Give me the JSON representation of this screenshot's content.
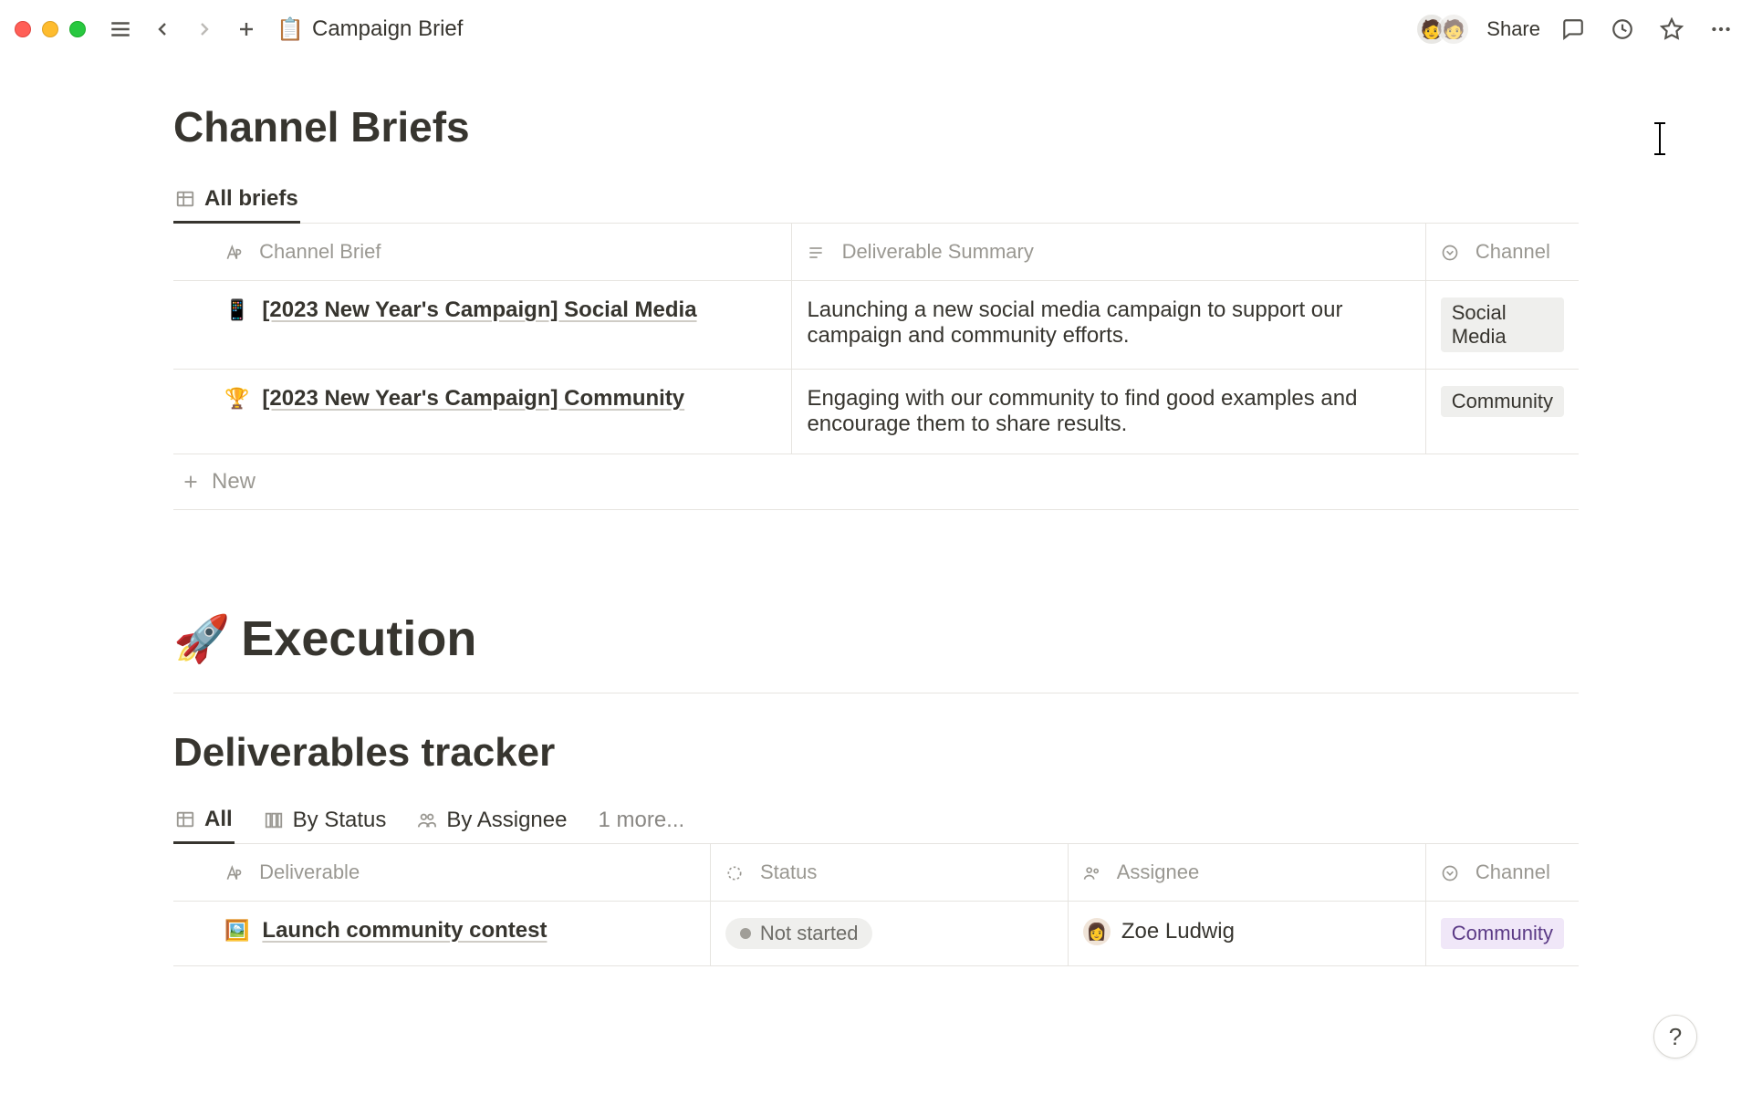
{
  "topbar": {
    "breadcrumb_icon": "📋",
    "breadcrumb_title": "Campaign Brief",
    "share_label": "Share"
  },
  "section_briefs": {
    "title": "Channel Briefs",
    "tabs": [
      {
        "label": "All briefs",
        "icon": "table"
      }
    ],
    "columns": {
      "name": "Channel Brief",
      "summary": "Deliverable Summary",
      "channel": "Channel"
    },
    "rows": [
      {
        "icon": "📱",
        "title": "[2023 New Year's Campaign] Social Media",
        "summary": "Launching a new social media campaign to support our campaign and community efforts.",
        "channel": "Social Media",
        "channel_tag_class": ""
      },
      {
        "icon": "🏆",
        "title": "[2023 New Year's Campaign] Community",
        "summary": "Engaging with our community to find good examples and encourage them to share results.",
        "channel": "Community",
        "channel_tag_class": ""
      }
    ],
    "new_label": "New"
  },
  "section_execution": {
    "emoji": "🚀",
    "title": "Execution"
  },
  "section_deliverables": {
    "title": "Deliverables tracker",
    "tabs": [
      {
        "label": "All",
        "icon": "table"
      },
      {
        "label": "By Status",
        "icon": "board"
      },
      {
        "label": "By Assignee",
        "icon": "people"
      }
    ],
    "more_label": "1 more...",
    "columns": {
      "name": "Deliverable",
      "status": "Status",
      "assignee": "Assignee",
      "channel": "Channel"
    },
    "rows": [
      {
        "icon": "🖼️",
        "title": "Launch community contest",
        "status": "Not started",
        "assignee": "Zoe Ludwig",
        "channel": "Community"
      }
    ]
  },
  "help_label": "?"
}
